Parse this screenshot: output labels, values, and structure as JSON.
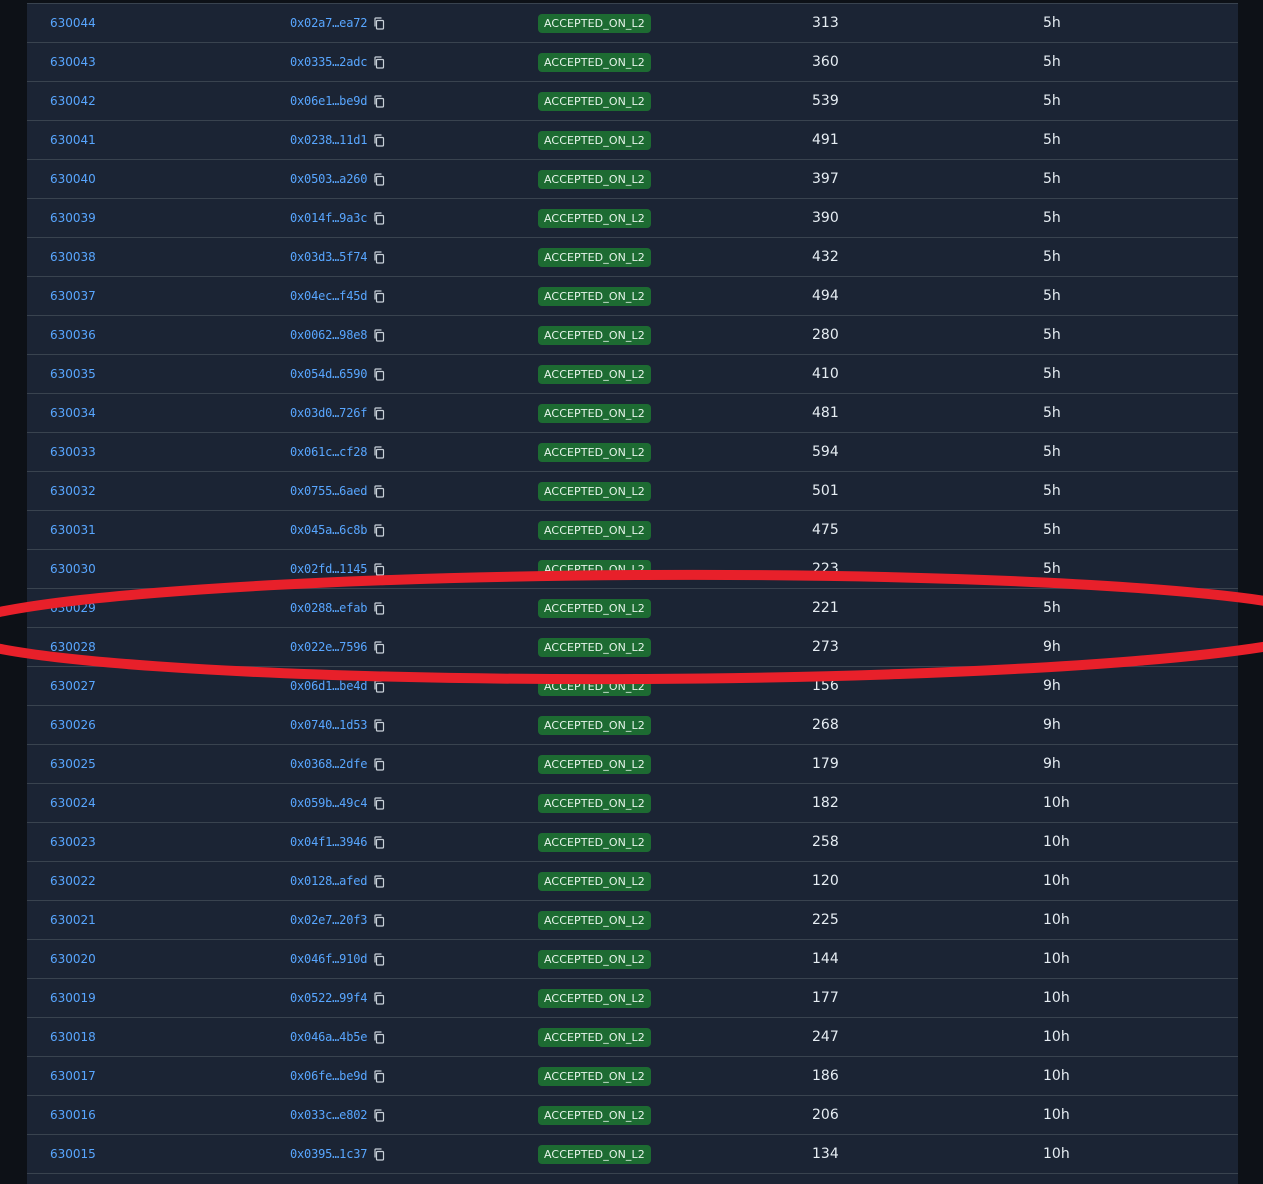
{
  "table": {
    "rows": [
      {
        "block": "630044",
        "hash": "0x02a7…ea72",
        "status": "ACCEPTED_ON_L2",
        "tx_count": "313",
        "age": "5h"
      },
      {
        "block": "630043",
        "hash": "0x0335…2adc",
        "status": "ACCEPTED_ON_L2",
        "tx_count": "360",
        "age": "5h"
      },
      {
        "block": "630042",
        "hash": "0x06e1…be9d",
        "status": "ACCEPTED_ON_L2",
        "tx_count": "539",
        "age": "5h"
      },
      {
        "block": "630041",
        "hash": "0x0238…11d1",
        "status": "ACCEPTED_ON_L2",
        "tx_count": "491",
        "age": "5h"
      },
      {
        "block": "630040",
        "hash": "0x0503…a260",
        "status": "ACCEPTED_ON_L2",
        "tx_count": "397",
        "age": "5h"
      },
      {
        "block": "630039",
        "hash": "0x014f…9a3c",
        "status": "ACCEPTED_ON_L2",
        "tx_count": "390",
        "age": "5h"
      },
      {
        "block": "630038",
        "hash": "0x03d3…5f74",
        "status": "ACCEPTED_ON_L2",
        "tx_count": "432",
        "age": "5h"
      },
      {
        "block": "630037",
        "hash": "0x04ec…f45d",
        "status": "ACCEPTED_ON_L2",
        "tx_count": "494",
        "age": "5h"
      },
      {
        "block": "630036",
        "hash": "0x0062…98e8",
        "status": "ACCEPTED_ON_L2",
        "tx_count": "280",
        "age": "5h"
      },
      {
        "block": "630035",
        "hash": "0x054d…6590",
        "status": "ACCEPTED_ON_L2",
        "tx_count": "410",
        "age": "5h"
      },
      {
        "block": "630034",
        "hash": "0x03d0…726f",
        "status": "ACCEPTED_ON_L2",
        "tx_count": "481",
        "age": "5h"
      },
      {
        "block": "630033",
        "hash": "0x061c…cf28",
        "status": "ACCEPTED_ON_L2",
        "tx_count": "594",
        "age": "5h"
      },
      {
        "block": "630032",
        "hash": "0x0755…6aed",
        "status": "ACCEPTED_ON_L2",
        "tx_count": "501",
        "age": "5h"
      },
      {
        "block": "630031",
        "hash": "0x045a…6c8b",
        "status": "ACCEPTED_ON_L2",
        "tx_count": "475",
        "age": "5h"
      },
      {
        "block": "630030",
        "hash": "0x02fd…1145",
        "status": "ACCEPTED_ON_L2",
        "tx_count": "223",
        "age": "5h"
      },
      {
        "block": "630029",
        "hash": "0x0288…efab",
        "status": "ACCEPTED_ON_L2",
        "tx_count": "221",
        "age": "5h"
      },
      {
        "block": "630028",
        "hash": "0x022e…7596",
        "status": "ACCEPTED_ON_L2",
        "tx_count": "273",
        "age": "9h"
      },
      {
        "block": "630027",
        "hash": "0x06d1…be4d",
        "status": "ACCEPTED_ON_L2",
        "tx_count": "156",
        "age": "9h"
      },
      {
        "block": "630026",
        "hash": "0x0740…1d53",
        "status": "ACCEPTED_ON_L2",
        "tx_count": "268",
        "age": "9h"
      },
      {
        "block": "630025",
        "hash": "0x0368…2dfe",
        "status": "ACCEPTED_ON_L2",
        "tx_count": "179",
        "age": "9h"
      },
      {
        "block": "630024",
        "hash": "0x059b…49c4",
        "status": "ACCEPTED_ON_L2",
        "tx_count": "182",
        "age": "10h"
      },
      {
        "block": "630023",
        "hash": "0x04f1…3946",
        "status": "ACCEPTED_ON_L2",
        "tx_count": "258",
        "age": "10h"
      },
      {
        "block": "630022",
        "hash": "0x0128…afed",
        "status": "ACCEPTED_ON_L2",
        "tx_count": "120",
        "age": "10h"
      },
      {
        "block": "630021",
        "hash": "0x02e7…20f3",
        "status": "ACCEPTED_ON_L2",
        "tx_count": "225",
        "age": "10h"
      },
      {
        "block": "630020",
        "hash": "0x046f…910d",
        "status": "ACCEPTED_ON_L2",
        "tx_count": "144",
        "age": "10h"
      },
      {
        "block": "630019",
        "hash": "0x0522…99f4",
        "status": "ACCEPTED_ON_L2",
        "tx_count": "177",
        "age": "10h"
      },
      {
        "block": "630018",
        "hash": "0x046a…4b5e",
        "status": "ACCEPTED_ON_L2",
        "tx_count": "247",
        "age": "10h"
      },
      {
        "block": "630017",
        "hash": "0x06fe…be9d",
        "status": "ACCEPTED_ON_L2",
        "tx_count": "186",
        "age": "10h"
      },
      {
        "block": "630016",
        "hash": "0x033c…e802",
        "status": "ACCEPTED_ON_L2",
        "tx_count": "206",
        "age": "10h"
      },
      {
        "block": "630015",
        "hash": "0x0395…1c37",
        "status": "ACCEPTED_ON_L2",
        "tx_count": "134",
        "age": "10h"
      }
    ]
  },
  "icons": {
    "copy": "copy-icon"
  },
  "colors": {
    "page_background": "#0d1117",
    "table_background": "#1b2434",
    "row_divider": "#39434f",
    "link": "#58a6ff",
    "badge_background": "#1d6b32",
    "badge_text": "#e6f4ea",
    "text": "#e6edf3",
    "annotation": "#e8202a"
  }
}
